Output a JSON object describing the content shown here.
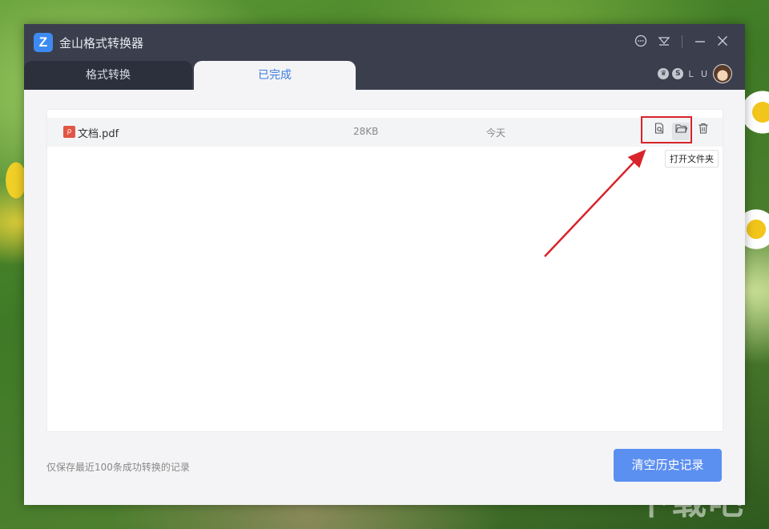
{
  "window": {
    "title": "金山格式转换器",
    "logo_letter": "Z"
  },
  "titlebar_icons": [
    "chat-icon",
    "menu-icon",
    "minimize-icon",
    "close-icon"
  ],
  "tabs": [
    {
      "label": "格式转换",
      "active": false
    },
    {
      "label": "已完成",
      "active": true
    }
  ],
  "user": {
    "name": "L U"
  },
  "files": [
    {
      "name": "文档.pdf",
      "size": "28KB",
      "date": "今天",
      "type_icon": "pdf-icon"
    }
  ],
  "row_actions": [
    "preview-icon",
    "open-folder-icon",
    "delete-icon"
  ],
  "tooltip": "打开文件夹",
  "footer": {
    "note": "仅保存最近100条成功转换的记录",
    "clear_button": "清空历史记录"
  },
  "watermark": "下载吧",
  "colors": {
    "titlebar": "#3b3f4d",
    "accent": "#3c7be0",
    "button": "#5b8ff0",
    "highlight": "#d8242a"
  }
}
